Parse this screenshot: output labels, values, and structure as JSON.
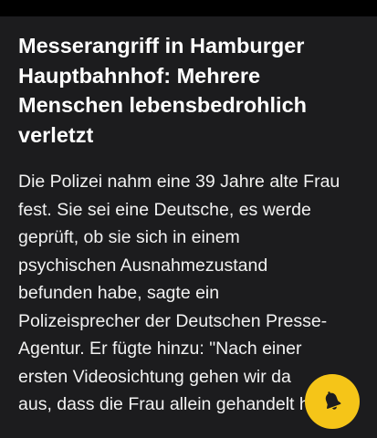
{
  "article": {
    "headline_lines": [
      "Messerangriff in Hamburger",
      "Hauptbahnhof: Mehrere",
      "Menschen lebensbedrohlich",
      "verletzt"
    ],
    "body_lines": [
      "Die Polizei nahm eine 39 Jahre alte Frau",
      "fest. Sie sei eine Deutsche, es werde",
      "geprüft, ob sie sich in einem",
      "psychischen Ausnahmezustand",
      "befunden habe, sagte ein",
      "Polizeisprecher der Deutschen Presse-",
      "Agentur. Er fügte hinzu: \"Nach einer",
      "ersten Videosichtung gehen wir da",
      "aus, dass die Frau allein gehandelt hat."
    ]
  },
  "notification_button": {
    "icon": "bell-icon",
    "background_color": "#f5c518",
    "icon_color": "#1c1c1e"
  },
  "colors": {
    "page_background": "#000000",
    "card_background": "#1c1c1e",
    "text": "#ffffff"
  }
}
